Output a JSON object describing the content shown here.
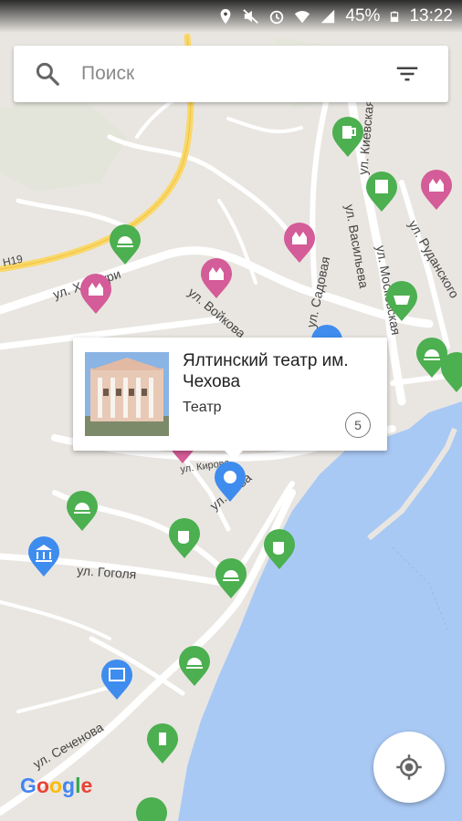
{
  "status_bar": {
    "battery": "45%",
    "time": "13:22"
  },
  "search": {
    "placeholder": "Поиск"
  },
  "streets": {
    "khalturina": "ул. Халтури",
    "voykova": "ул. Войкова",
    "sadovaya": "ул. Садовая",
    "kievskaya": "ул. Киевская",
    "vasilyeva": "ул. Васильева",
    "moskovskaya": "ул. Московская",
    "rudanskogo": "ул. Руданского",
    "kirova": "ул. Кирова",
    "lva": "ул. Льва",
    "gogolya": "ул. Гоголя",
    "sechenova": "ул. Сеченова",
    "highway": "H19"
  },
  "place_card": {
    "title": "Ялтинский театр им. Чехова",
    "category": "Театр",
    "count": "5"
  },
  "google_logo": [
    "G",
    "o",
    "o",
    "g",
    "l",
    "e"
  ],
  "colors": {
    "food_pin": "#4caf50",
    "attraction_pin": "#d45c98",
    "culture_pin": "#3f8cef",
    "sea": "#a9c9f5",
    "land": "#e9e6e1"
  }
}
